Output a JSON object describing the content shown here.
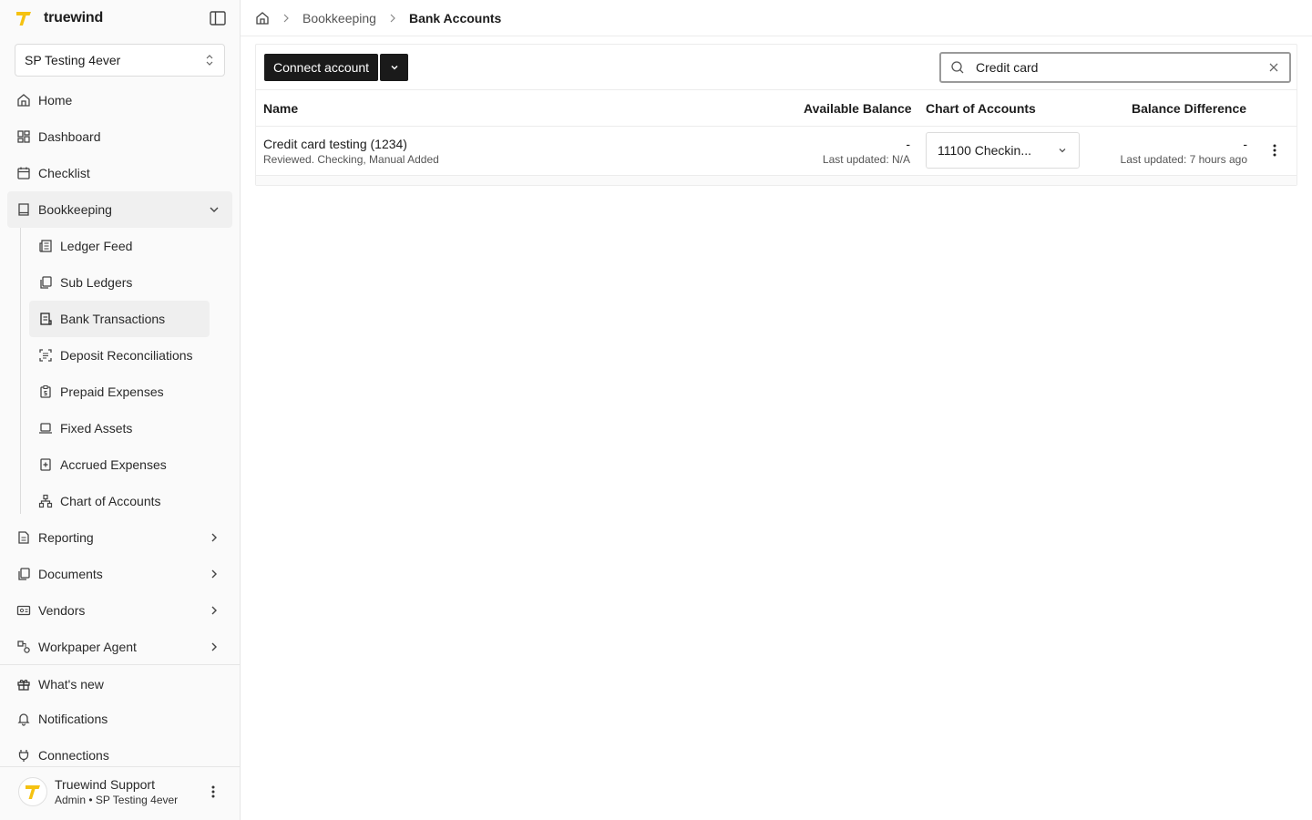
{
  "brand": {
    "name": "truewind",
    "accent": "#f5c211"
  },
  "org": {
    "selected": "SP Testing 4ever"
  },
  "nav": {
    "home": "Home",
    "dashboard": "Dashboard",
    "checklist": "Checklist",
    "bookkeeping": "Bookkeeping",
    "sub": {
      "ledger_feed": "Ledger Feed",
      "sub_ledgers": "Sub Ledgers",
      "bank_transactions": "Bank Transactions",
      "deposit_reconciliations": "Deposit Reconciliations",
      "prepaid_expenses": "Prepaid Expenses",
      "fixed_assets": "Fixed Assets",
      "accrued_expenses": "Accrued Expenses",
      "chart_of_accounts": "Chart of Accounts"
    },
    "reporting": "Reporting",
    "documents": "Documents",
    "vendors": "Vendors",
    "workpaper_agent": "Workpaper Agent"
  },
  "bottom": {
    "whats_new": "What's new",
    "notifications": "Notifications",
    "connections": "Connections"
  },
  "user": {
    "name": "Truewind Support",
    "role": "Admin • SP Testing 4ever"
  },
  "breadcrumb": {
    "section": "Bookkeeping",
    "current": "Bank Accounts"
  },
  "toolbar": {
    "connect_label": "Connect account"
  },
  "search": {
    "value": "Credit card",
    "placeholder": "Search"
  },
  "table": {
    "headers": {
      "name": "Name",
      "available_balance": "Available Balance",
      "chart_of_accounts": "Chart of Accounts",
      "balance_difference": "Balance Difference"
    },
    "rows": [
      {
        "name": "Credit card testing (1234)",
        "subtitle": "Reviewed. Checking, Manual Added",
        "available_balance": "-",
        "available_updated": "Last updated: N/A",
        "coa": "11100 Checkin...",
        "balance_difference": "-",
        "difference_updated": "Last updated: 7 hours ago"
      }
    ]
  }
}
